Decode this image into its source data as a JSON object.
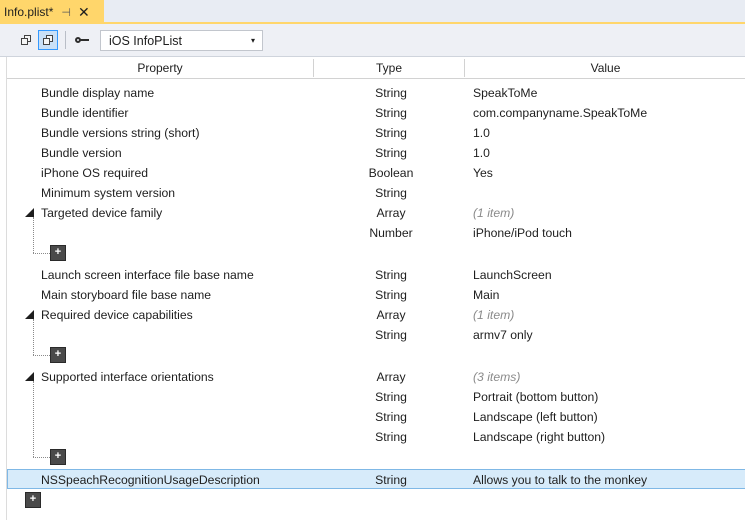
{
  "tab": {
    "title": "Info.plist*",
    "pin_glyph": "⊣",
    "close_glyph": "✕"
  },
  "toolbar": {
    "dropdown_value": "iOS InfoPList",
    "dropdown_arrow": "▾"
  },
  "columns": {
    "property": "Property",
    "type": "Type",
    "value": "Value"
  },
  "rows": [
    {
      "property": "Bundle display name",
      "type": "String",
      "value": "SpeakToMe"
    },
    {
      "property": "Bundle identifier",
      "type": "String",
      "value": "com.companyname.SpeakToMe"
    },
    {
      "property": "Bundle versions string (short)",
      "type": "String",
      "value": "1.0"
    },
    {
      "property": "Bundle version",
      "type": "String",
      "value": "1.0"
    },
    {
      "property": "iPhone OS required",
      "type": "Boolean",
      "value": "Yes"
    },
    {
      "property": "Minimum system version",
      "type": "String",
      "value": ""
    },
    {
      "property": "Targeted device family",
      "type": "Array",
      "value": "(1 item)"
    },
    {
      "property": "",
      "type": "Number",
      "value": "iPhone/iPod touch"
    },
    {
      "property": "Launch screen interface file base name",
      "type": "String",
      "value": "LaunchScreen"
    },
    {
      "property": "Main storyboard file base name",
      "type": "String",
      "value": "Main"
    },
    {
      "property": "Required device capabilities",
      "type": "Array",
      "value": "(1 item)"
    },
    {
      "property": "",
      "type": "String",
      "value": "armv7 only"
    },
    {
      "property": "Supported interface orientations",
      "type": "Array",
      "value": "(3 items)"
    },
    {
      "property": "",
      "type": "String",
      "value": "Portrait (bottom button)"
    },
    {
      "property": "",
      "type": "String",
      "value": "Landscape (left button)"
    },
    {
      "property": "",
      "type": "String",
      "value": "Landscape (right button)"
    },
    {
      "property": "NSSpeachRecognitionUsageDescription",
      "type": "String",
      "value": "Allows you to talk to the monkey"
    }
  ],
  "add_glyph": "+"
}
